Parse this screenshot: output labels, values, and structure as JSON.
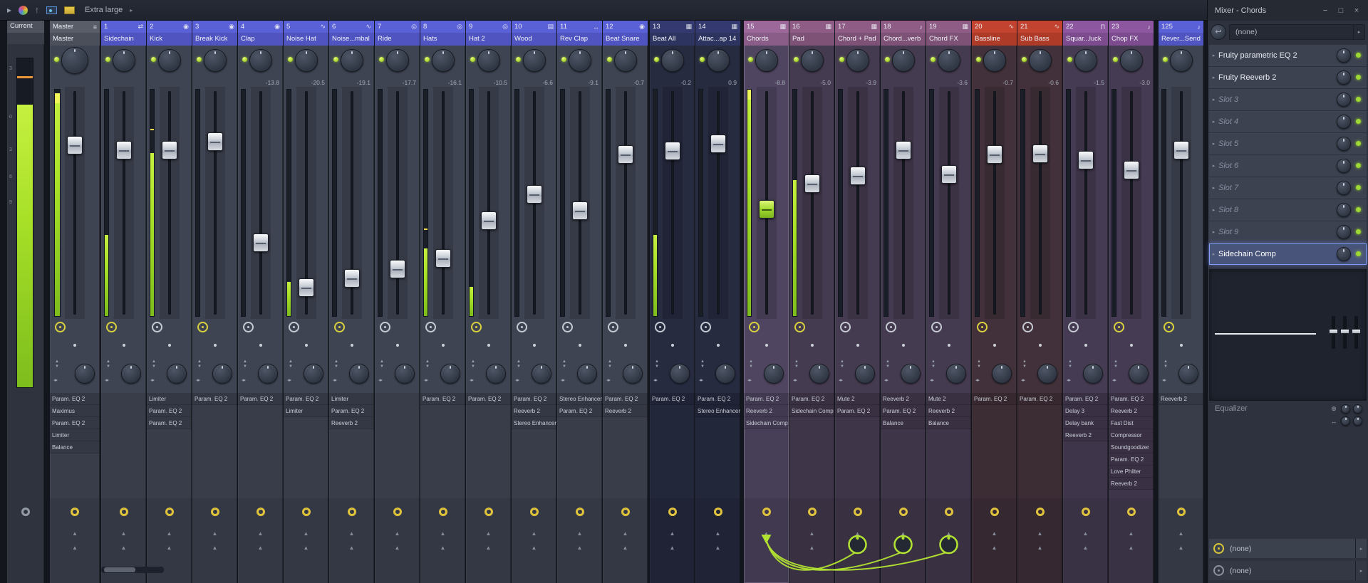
{
  "window": {
    "title": "Mixer - Chords",
    "buttons": {
      "minimize": "−",
      "maximize": "□",
      "close": "×"
    }
  },
  "toolbar": {
    "zoom_label": "Extra large"
  },
  "glyphs": {
    "chevron_right": "▸",
    "play": "▸",
    "up_arrow": "↑",
    "up_triangle": "▲",
    "down_triangle": "▼",
    "lr_triangles": "◂▸",
    "return_arrow": "↩",
    "plus_circle": "⊕",
    "lr_arrow": "↔"
  },
  "current": {
    "label": "Current",
    "scale": [
      "3",
      "0",
      "3",
      "6",
      "9"
    ],
    "meter": 0.86,
    "peak": 0.94
  },
  "sends": {
    "source_track": "15",
    "target_tracks": [
      "17",
      "18",
      "19"
    ]
  },
  "tracks": [
    {
      "num": "",
      "name": "Master",
      "icon": "≡",
      "group": "master",
      "db": "",
      "fader": 0.226,
      "meter": 0.985,
      "tip": true,
      "peak": 0,
      "clock": "yellow",
      "handle": "silver",
      "bottom": "arrows",
      "gap": 0,
      "master": true,
      "fx": [
        "Param. EQ 2",
        "Maximus",
        "Param. EQ 2",
        "Limiter",
        "Balance"
      ]
    },
    {
      "num": "1",
      "name": "Sidechain",
      "icon": "⇄",
      "group": "blue",
      "db": "",
      "fader": 0.247,
      "meter": 0.36,
      "peak": 0,
      "clock": "yellow",
      "handle": "silver",
      "bottom": "arrows",
      "gap": 0,
      "fx": []
    },
    {
      "num": "2",
      "name": "Kick",
      "icon": "◉",
      "group": "blue",
      "db": "",
      "fader": 0.247,
      "meter": 0.72,
      "peak": 0.82,
      "clock": "white",
      "handle": "silver",
      "bottom": "arrows",
      "gap": 0,
      "fx": [
        "Limiter",
        "Param. EQ 2",
        "Param. EQ 2"
      ]
    },
    {
      "num": "3",
      "name": "Break Kick",
      "icon": "◉",
      "group": "blue",
      "db": "",
      "fader": 0.206,
      "meter": 0,
      "peak": 0,
      "clock": "yellow",
      "handle": "silver",
      "bottom": "arrows",
      "gap": 0,
      "fx": [
        "Param. EQ 2"
      ]
    },
    {
      "num": "4",
      "name": "Clap",
      "icon": "◉",
      "group": "blue",
      "db": "-13.8",
      "fader": 0.69,
      "meter": 0,
      "peak": 0,
      "clock": "white",
      "handle": "silver",
      "bottom": "arrows",
      "gap": 0,
      "fx": [
        "Param. EQ 2"
      ]
    },
    {
      "num": "5",
      "name": "Noise Hat",
      "icon": "∿",
      "group": "blue",
      "db": "-20.5",
      "fader": 0.905,
      "meter": 0.15,
      "peak": 0,
      "clock": "white",
      "handle": "silver",
      "bottom": "arrows",
      "gap": 0,
      "fx": [
        "Param. EQ 2",
        "Limiter"
      ]
    },
    {
      "num": "6",
      "name": "Noise...mbal",
      "icon": "∿",
      "group": "blue",
      "db": "-19.1",
      "fader": 0.86,
      "meter": 0,
      "peak": 0,
      "clock": "yellow",
      "handle": "silver",
      "bottom": "arrows",
      "gap": 0,
      "fx": [
        "Limiter",
        "Param. EQ 2",
        "Reeverb 2"
      ]
    },
    {
      "num": "7",
      "name": "Ride",
      "icon": "◎",
      "group": "blue",
      "db": "-17.7",
      "fader": 0.815,
      "meter": 0,
      "peak": 0,
      "clock": "white",
      "handle": "silver",
      "bottom": "arrows",
      "gap": 0,
      "fx": []
    },
    {
      "num": "8",
      "name": "Hats",
      "icon": "◎",
      "group": "blue",
      "db": "-16.1",
      "fader": 0.764,
      "meter": 0.3,
      "peak": 0.38,
      "clock": "white",
      "handle": "silver",
      "bottom": "arrows",
      "gap": 0,
      "fx": [
        "Param. EQ 2"
      ]
    },
    {
      "num": "9",
      "name": "Hat 2",
      "icon": "◎",
      "group": "blue",
      "db": "-10.5",
      "fader": 0.584,
      "meter": 0.13,
      "peak": 0,
      "clock": "yellow",
      "handle": "silver",
      "bottom": "arrows",
      "gap": 0,
      "fx": [
        "Param. EQ 2"
      ]
    },
    {
      "num": "10",
      "name": "Wood",
      "icon": "▤",
      "group": "blue",
      "db": "-6.6",
      "fader": 0.459,
      "meter": 0,
      "peak": 0,
      "clock": "white",
      "handle": "silver",
      "bottom": "arrows",
      "gap": 0,
      "fx": [
        "Param. EQ 2",
        "Reeverb 2",
        "Stereo Enhancer"
      ]
    },
    {
      "num": "11",
      "name": "Rev Clap",
      "icon": "↔",
      "group": "blue",
      "db": "-9.1",
      "fader": 0.539,
      "meter": 0,
      "peak": 0,
      "clock": "white",
      "handle": "silver",
      "bottom": "arrows",
      "gap": 0,
      "fx": [
        "Stereo Enhancer",
        "Param. EQ 2"
      ]
    },
    {
      "num": "12",
      "name": "Beat Snare",
      "icon": "◉",
      "group": "blue",
      "db": "-0.7",
      "fader": 0.269,
      "meter": 0,
      "peak": 0,
      "clock": "white",
      "handle": "silver",
      "bottom": "arrows",
      "gap": 0,
      "fx": [
        "Param. EQ 2",
        "Reeverb 2"
      ]
    },
    {
      "num": "13",
      "name": "Beat All",
      "icon": "▦",
      "group": "navy",
      "db": "-0.2",
      "fader": 0.253,
      "meter": 0.36,
      "peak": 0,
      "clock": "white",
      "handle": "silver",
      "bottom": "arrows",
      "gap": 2,
      "fx": [
        "Param. EQ 2"
      ]
    },
    {
      "num": "14",
      "name": "Attac...ap 14",
      "icon": "▦",
      "group": "navy",
      "db": "0.9",
      "fader": 0.218,
      "meter": 0,
      "peak": 0,
      "clock": "white",
      "handle": "silver",
      "bottom": "arrows",
      "gap": 0,
      "fx": [
        "Param. EQ 2",
        "Stereo Enhancer"
      ]
    },
    {
      "num": "15",
      "name": "Chords",
      "icon": "▦",
      "group": "purplesel",
      "db": "-8.8",
      "fader": 0.529,
      "meter": 1.0,
      "tip": true,
      "peak": 0,
      "clock": "yellow",
      "handle": "green",
      "bottom": "source",
      "gap": 4,
      "selected": true,
      "fx": [
        "Param. EQ 2",
        "Reeverb 2",
        "Sidechain Comp"
      ]
    },
    {
      "num": "16",
      "name": "Pad",
      "icon": "▦",
      "group": "purple",
      "db": "-5.0",
      "fader": 0.408,
      "meter": 0.6,
      "peak": 0,
      "clock": "yellow",
      "handle": "silver",
      "bottom": "arrows",
      "gap": 0,
      "fx": [
        "Param. EQ 2",
        "Sidechain Comp"
      ]
    },
    {
      "num": "17",
      "name": "Chord + Pad",
      "icon": "▦",
      "group": "purple",
      "db": "-3.9",
      "fader": 0.372,
      "meter": 0,
      "peak": 0,
      "clock": "white",
      "handle": "silver",
      "bottom": "knob",
      "gap": 0,
      "fx": [
        "Mute 2",
        "Param. EQ 2"
      ]
    },
    {
      "num": "18",
      "name": "Chord...verb",
      "icon": "♪",
      "group": "purple",
      "db": "",
      "fader": 0.247,
      "meter": 0,
      "peak": 0,
      "clock": "white",
      "handle": "silver",
      "bottom": "knob",
      "gap": 0,
      "fx": [
        "Reeverb 2",
        "Param. EQ 2",
        "Balance"
      ]
    },
    {
      "num": "19",
      "name": "Chord FX",
      "icon": "▦",
      "group": "purple",
      "db": "-3.6",
      "fader": 0.363,
      "meter": 0,
      "peak": 0,
      "clock": "white",
      "handle": "silver",
      "bottom": "knob",
      "gap": 0,
      "fx": [
        "Mute 2",
        "Reeverb 2",
        "Balance"
      ]
    },
    {
      "num": "20",
      "name": "Bassline",
      "icon": "∿",
      "group": "red",
      "db": "-0.7",
      "fader": 0.269,
      "meter": 0,
      "peak": 0,
      "clock": "yellow",
      "handle": "silver",
      "bottom": "arrows",
      "gap": 0,
      "fx": [
        "Param. EQ 2"
      ]
    },
    {
      "num": "21",
      "name": "Sub Bass",
      "icon": "∿",
      "group": "red",
      "db": "-0.6",
      "fader": 0.266,
      "meter": 0,
      "peak": 0,
      "clock": "white",
      "handle": "silver",
      "bottom": "arrows",
      "gap": 0,
      "fx": [
        "Param. EQ 2"
      ]
    },
    {
      "num": "22",
      "name": "Squar...luck",
      "icon": "П",
      "group": "violet",
      "db": "-1.5",
      "fader": 0.295,
      "meter": 0,
      "peak": 0,
      "clock": "white",
      "handle": "silver",
      "bottom": "arrows",
      "gap": 0,
      "fx": [
        "Param. EQ 2",
        "Delay 3",
        "Delay bank",
        "Reeverb 2"
      ]
    },
    {
      "num": "23",
      "name": "Chop FX",
      "icon": "♪",
      "group": "violet",
      "db": "-3.0",
      "fader": 0.343,
      "meter": 0,
      "peak": 0,
      "clock": "yellow",
      "handle": "silver",
      "bottom": "arrows",
      "gap": 0,
      "fx": [
        "Param. EQ 2",
        "Reeverb 2",
        "Fast Dist",
        "Compressor",
        "Soundgoodizer",
        "Param. EQ 2",
        "Love Philter",
        "Reeverb 2"
      ]
    },
    {
      "num": "125",
      "name": "Rever...Send",
      "icon": "♪",
      "group": "blue",
      "db": "",
      "fader": 0.247,
      "meter": 0,
      "peak": 0,
      "clock": "yellow",
      "handle": "silver",
      "bottom": "arrows",
      "gap": 6,
      "fx": [
        "Reeverb 2"
      ]
    }
  ],
  "panel": {
    "input": {
      "label": "(none)"
    },
    "slots": [
      {
        "label": "Fruity parametric EQ 2",
        "state": "filled"
      },
      {
        "label": "Fruity Reeverb 2",
        "state": "filled"
      },
      {
        "label": "Slot 3",
        "state": "empty"
      },
      {
        "label": "Slot 4",
        "state": "empty"
      },
      {
        "label": "Slot 5",
        "state": "empty"
      },
      {
        "label": "Slot 6",
        "state": "empty"
      },
      {
        "label": "Slot 7",
        "state": "empty"
      },
      {
        "label": "Slot 8",
        "state": "empty"
      },
      {
        "label": "Slot 9",
        "state": "empty"
      },
      {
        "label": "Sidechain Comp",
        "state": "selected"
      }
    ],
    "equalizer_label": "Equalizer",
    "outputs": [
      {
        "label": "(none)"
      },
      {
        "label": "(none)"
      }
    ]
  },
  "colors": {
    "meter_green": "#a8e028",
    "meter_tip": "#eef65a",
    "peak_yellow": "#f0dc46",
    "cable_green": "#b2e332",
    "led_green": "#b4e23c",
    "selected_slot_blue": "#7fa0f5",
    "groups": {
      "master": {
        "h1": "#585d68",
        "h2": "#4a4f5a",
        "body": "#3f4452"
      },
      "blue": {
        "h1": "#5a60d6",
        "h2": "#4f54c0",
        "body": "#3f4452"
      },
      "navy": {
        "h1": "#343a70",
        "h2": "#2e3460",
        "body": "#272b40"
      },
      "purple": {
        "h1": "#8f5c86",
        "h2": "#7e5176",
        "body": "#453b50"
      },
      "purplesel": {
        "h1": "#9c689a",
        "h2": "#8a5c88",
        "body": "#4f4560"
      },
      "red": {
        "h1": "#c24430",
        "h2": "#ae3a28",
        "body": "#42313a"
      },
      "violet": {
        "h1": "#8d57a0",
        "h2": "#7c4c8e",
        "body": "#453b52"
      }
    }
  }
}
